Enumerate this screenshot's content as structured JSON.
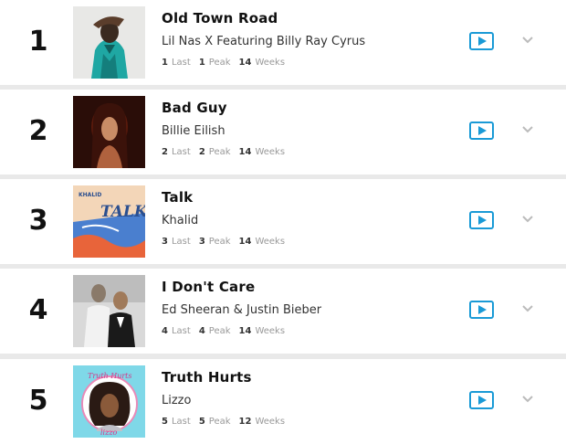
{
  "colors": {
    "play_accent": "#1a9ad6",
    "chevron": "#bbbbbb",
    "separator": "#e9e9e9"
  },
  "labels": {
    "last": "Last",
    "peak": "Peak",
    "weeks": "Weeks"
  },
  "rows": [
    {
      "rank": "1",
      "title": "Old Town Road",
      "artist": "Lil Nas X Featuring Billy Ray Cyrus",
      "last": "1",
      "peak": "1",
      "weeks": "14",
      "art_icon": "album-art-old-town-road"
    },
    {
      "rank": "2",
      "title": "Bad Guy",
      "artist": "Billie Eilish",
      "last": "2",
      "peak": "2",
      "weeks": "14",
      "art_icon": "album-art-bad-guy"
    },
    {
      "rank": "3",
      "title": "Talk",
      "artist": "Khalid",
      "last": "3",
      "peak": "3",
      "weeks": "14",
      "art_icon": "album-art-talk",
      "art_text": [
        "KHALID",
        "TALK"
      ]
    },
    {
      "rank": "4",
      "title": "I Don't Care",
      "artist": "Ed Sheeran & Justin Bieber",
      "last": "4",
      "peak": "4",
      "weeks": "14",
      "art_icon": "album-art-i-dont-care"
    },
    {
      "rank": "5",
      "title": "Truth Hurts",
      "artist": "Lizzo",
      "last": "5",
      "peak": "5",
      "weeks": "12",
      "art_icon": "album-art-truth-hurts",
      "art_text": [
        "Truth Hurts",
        "lizzo"
      ]
    }
  ],
  "icons": {
    "play": "play-icon",
    "expand": "chevron-down-icon"
  }
}
